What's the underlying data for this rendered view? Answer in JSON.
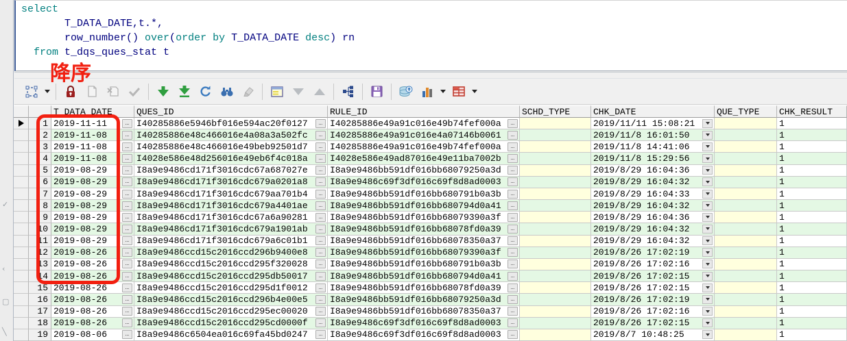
{
  "editor": {
    "language": "sql",
    "colors": {
      "keyword": "#007f7f",
      "identifier": "#00007f"
    },
    "lines": [
      [
        {
          "t": "select",
          "c": "kw"
        }
      ],
      [
        {
          "t": "       T_DATA_DATE,t.*,",
          "c": "id"
        }
      ],
      [
        {
          "t": "       row_number() ",
          "c": "id"
        },
        {
          "t": "over",
          "c": "kw"
        },
        {
          "t": "(",
          "c": "id"
        },
        {
          "t": "order by",
          "c": "kw"
        },
        {
          "t": " T_DATA_DATE ",
          "c": "id"
        },
        {
          "t": "desc",
          "c": "kw"
        },
        {
          "t": ") rn",
          "c": "id"
        }
      ],
      [
        {
          "t": "  ",
          "c": "id"
        },
        {
          "t": "from",
          "c": "kw"
        },
        {
          "t": " t_dqs_ques_stat t",
          "c": "id"
        }
      ]
    ]
  },
  "annotation": {
    "label": "降序",
    "color": "#f21f10"
  },
  "toolbar": {
    "buttons": [
      "select-mode",
      "lock",
      "paste-row",
      "delete-row",
      "post-changes",
      "fetch-next-page",
      "fetch-last-page",
      "refresh",
      "find",
      "clear",
      "single-record-view",
      "next-record",
      "previous-record",
      "tree-view",
      "save",
      "export-data",
      "chart",
      "export-grid"
    ]
  },
  "grid": {
    "columns": [
      "T_DATA_DATE",
      "QUES_ID",
      "RULE_ID",
      "SCHD_TYPE",
      "CHK_DATE",
      "QUE_TYPE",
      "CHK_RESULT"
    ],
    "current_row": 1,
    "stripe_color": "#e4f8e4",
    "null_cell_color": "#ffffde",
    "rows": [
      {
        "n": "1",
        "t_data_date": "2019-11-11",
        "ques_id": "I40285886e5946bf016e594ac20f0127",
        "rule_id": "I40285886e49a91c016e49b74fef000a",
        "schd_type": "",
        "chk_date": "2019/11/11 15:08:21",
        "que_type": "",
        "chk_result": "1"
      },
      {
        "n": "2",
        "t_data_date": "2019-11-08",
        "ques_id": "I40285886e48c466016e4a08a3a502fc",
        "rule_id": "I40285886e49a91c016e4a07146b0061",
        "schd_type": "",
        "chk_date": "2019/11/8 16:01:50",
        "que_type": "",
        "chk_result": "1"
      },
      {
        "n": "3",
        "t_data_date": "2019-11-08",
        "ques_id": "I40285886e48c466016e49beb92501d7",
        "rule_id": "I40285886e49a91c016e49b74fef000a",
        "schd_type": "",
        "chk_date": "2019/11/8 14:41:06",
        "que_type": "",
        "chk_result": "1"
      },
      {
        "n": "4",
        "t_data_date": "2019-11-08",
        "ques_id": "I4028e586e48d256016e49eb6f4c018a",
        "rule_id": "I4028e586e49ad87016e49e11ba7002b",
        "schd_type": "",
        "chk_date": "2019/11/8 15:29:56",
        "que_type": "",
        "chk_result": "1"
      },
      {
        "n": "5",
        "t_data_date": "2019-08-29",
        "ques_id": "I8a9e9486cd171f3016cdc67a687027e",
        "rule_id": "I8a9e9486bb591df016bb68079250a3d",
        "schd_type": "",
        "chk_date": "2019/8/29 16:04:36",
        "que_type": "",
        "chk_result": "1"
      },
      {
        "n": "6",
        "t_data_date": "2019-08-29",
        "ques_id": "I8a9e9486cd171f3016cdc679a0201a8",
        "rule_id": "I8a9e9486c69f3df016c69f8d8ad0003",
        "schd_type": "",
        "chk_date": "2019/8/29 16:04:32",
        "que_type": "",
        "chk_result": "1"
      },
      {
        "n": "7",
        "t_data_date": "2019-08-29",
        "ques_id": "I8a9e9486cd171f3016cdc679aa701b4",
        "rule_id": "I8a9e9486bb591df016bb680791b0a3b",
        "schd_type": "",
        "chk_date": "2019/8/29 16:04:33",
        "que_type": "",
        "chk_result": "1"
      },
      {
        "n": "8",
        "t_data_date": "2019-08-29",
        "ques_id": "I8a9e9486cd171f3016cdc679a4401ae",
        "rule_id": "I8a9e9486bb591df016bb680794d0a41",
        "schd_type": "",
        "chk_date": "2019/8/29 16:04:32",
        "que_type": "",
        "chk_result": "1"
      },
      {
        "n": "9",
        "t_data_date": "2019-08-29",
        "ques_id": "I8a9e9486cd171f3016cdc67a6a90281",
        "rule_id": "I8a9e9486bb591df016bb68079390a3f",
        "schd_type": "",
        "chk_date": "2019/8/29 16:04:36",
        "que_type": "",
        "chk_result": "1"
      },
      {
        "n": "10",
        "t_data_date": "2019-08-29",
        "ques_id": "I8a9e9486cd171f3016cdc679a1901ab",
        "rule_id": "I8a9e9486bb591df016bb68078fd0a39",
        "schd_type": "",
        "chk_date": "2019/8/29 16:04:32",
        "que_type": "",
        "chk_result": "1"
      },
      {
        "n": "11",
        "t_data_date": "2019-08-29",
        "ques_id": "I8a9e9486cd171f3016cdc679a6c01b1",
        "rule_id": "I8a9e9486bb591df016bb68078350a37",
        "schd_type": "",
        "chk_date": "2019/8/29 16:04:32",
        "que_type": "",
        "chk_result": "1"
      },
      {
        "n": "12",
        "t_data_date": "2019-08-26",
        "ques_id": "I8a9e9486ccd15c2016ccd296b9400e8",
        "rule_id": "I8a9e9486bb591df016bb68079390a3f",
        "schd_type": "",
        "chk_date": "2019/8/26 17:02:19",
        "que_type": "",
        "chk_result": "1"
      },
      {
        "n": "13",
        "t_data_date": "2019-08-26",
        "ques_id": "I8a9e9486ccd15c2016ccd295f320028",
        "rule_id": "I8a9e9486bb591df016bb680791b0a3b",
        "schd_type": "",
        "chk_date": "2019/8/26 17:02:16",
        "que_type": "",
        "chk_result": "1"
      },
      {
        "n": "14",
        "t_data_date": "2019-08-26",
        "ques_id": "I8a9e9486ccd15c2016ccd295db50017",
        "rule_id": "I8a9e9486bb591df016bb680794d0a41",
        "schd_type": "",
        "chk_date": "2019/8/26 17:02:15",
        "que_type": "",
        "chk_result": "1"
      },
      {
        "n": "15",
        "t_data_date": "2019-08-26",
        "ques_id": "I8a9e9486ccd15c2016ccd295d1f0012",
        "rule_id": "I8a9e9486bb591df016bb68078fd0a39",
        "schd_type": "",
        "chk_date": "2019/8/26 17:02:15",
        "que_type": "",
        "chk_result": "1"
      },
      {
        "n": "16",
        "t_data_date": "2019-08-26",
        "ques_id": "I8a9e9486ccd15c2016ccd296b4e00e5",
        "rule_id": "I8a9e9486bb591df016bb68079250a3d",
        "schd_type": "",
        "chk_date": "2019/8/26 17:02:19",
        "que_type": "",
        "chk_result": "1"
      },
      {
        "n": "17",
        "t_data_date": "2019-08-26",
        "ques_id": "I8a9e9486ccd15c2016ccd295ec00020",
        "rule_id": "I8a9e9486bb591df016bb68078350a37",
        "schd_type": "",
        "chk_date": "2019/8/26 17:02:16",
        "que_type": "",
        "chk_result": "1"
      },
      {
        "n": "18",
        "t_data_date": "2019-08-26",
        "ques_id": "I8a9e9486ccd15c2016ccd295cd0000f",
        "rule_id": "I8a9e9486c69f3df016c69f8d8ad0003",
        "schd_type": "",
        "chk_date": "2019/8/26 17:02:15",
        "que_type": "",
        "chk_result": "1"
      },
      {
        "n": "19",
        "t_data_date": "2019-08-06",
        "ques_id": "I8a9e9486c6504ea016c69fa45bd0247",
        "rule_id": "I8a9e9486c69f3df016c69f8d8ad0003",
        "schd_type": "",
        "chk_date": "2019/8/7 10:48:25",
        "que_type": "",
        "chk_result": "1"
      }
    ]
  }
}
